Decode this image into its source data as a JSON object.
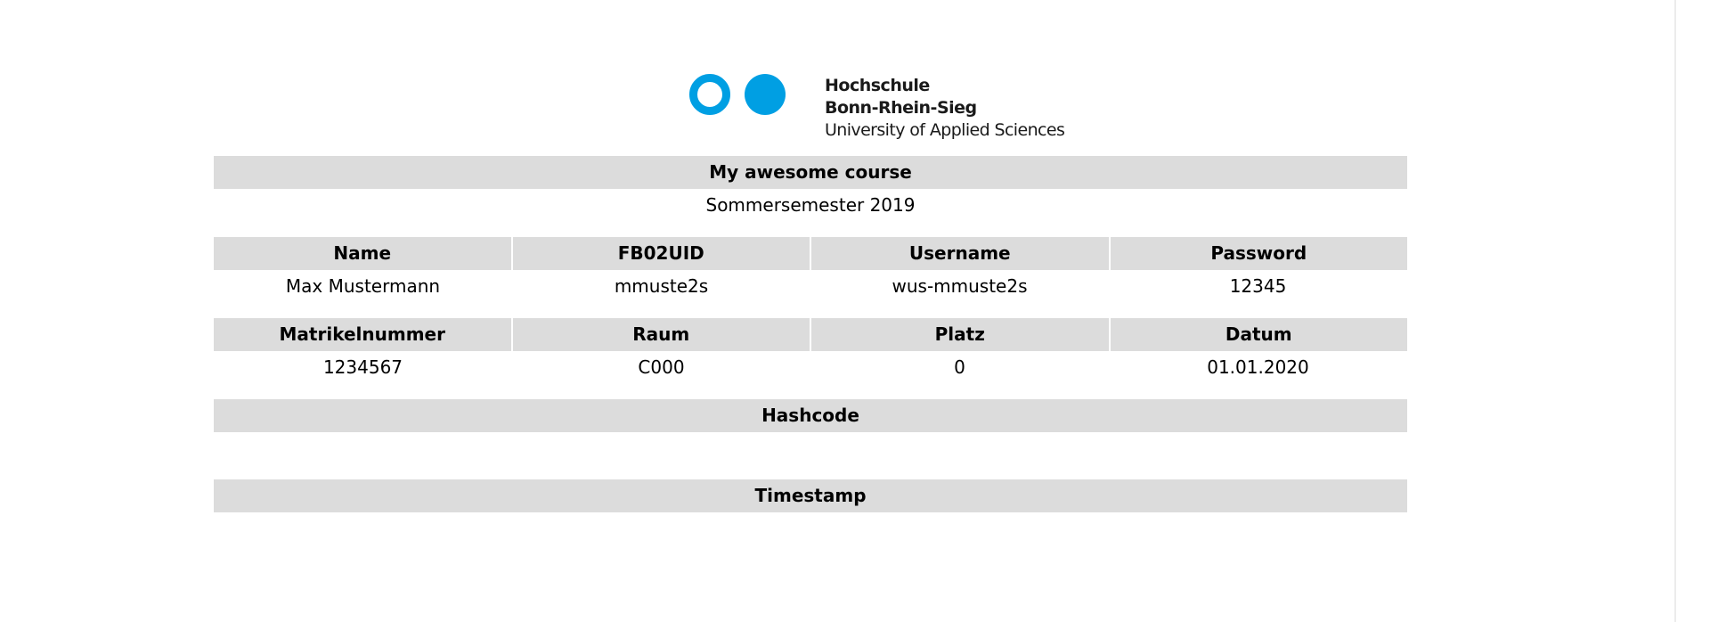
{
  "logo": {
    "brand_color": "#009fe3",
    "line1": "Hochschule",
    "line2": "Bonn-Rhein-Sieg",
    "line3": "University of Applied Sciences"
  },
  "course": {
    "title": "My awesome course",
    "semester": "Sommersemester 2019"
  },
  "table1": {
    "headers": [
      "Name",
      "FB02UID",
      "Username",
      "Password"
    ],
    "values": [
      "Max Mustermann",
      "mmuste2s",
      "wus-mmuste2s",
      "12345"
    ]
  },
  "table2": {
    "headers": [
      "Matrikelnummer",
      "Raum",
      "Platz",
      "Datum"
    ],
    "values": [
      "1234567",
      "C000",
      "0",
      "01.01.2020"
    ]
  },
  "hashcode": {
    "label": "Hashcode",
    "value": ""
  },
  "timestamp": {
    "label": "Timestamp",
    "value": ""
  }
}
